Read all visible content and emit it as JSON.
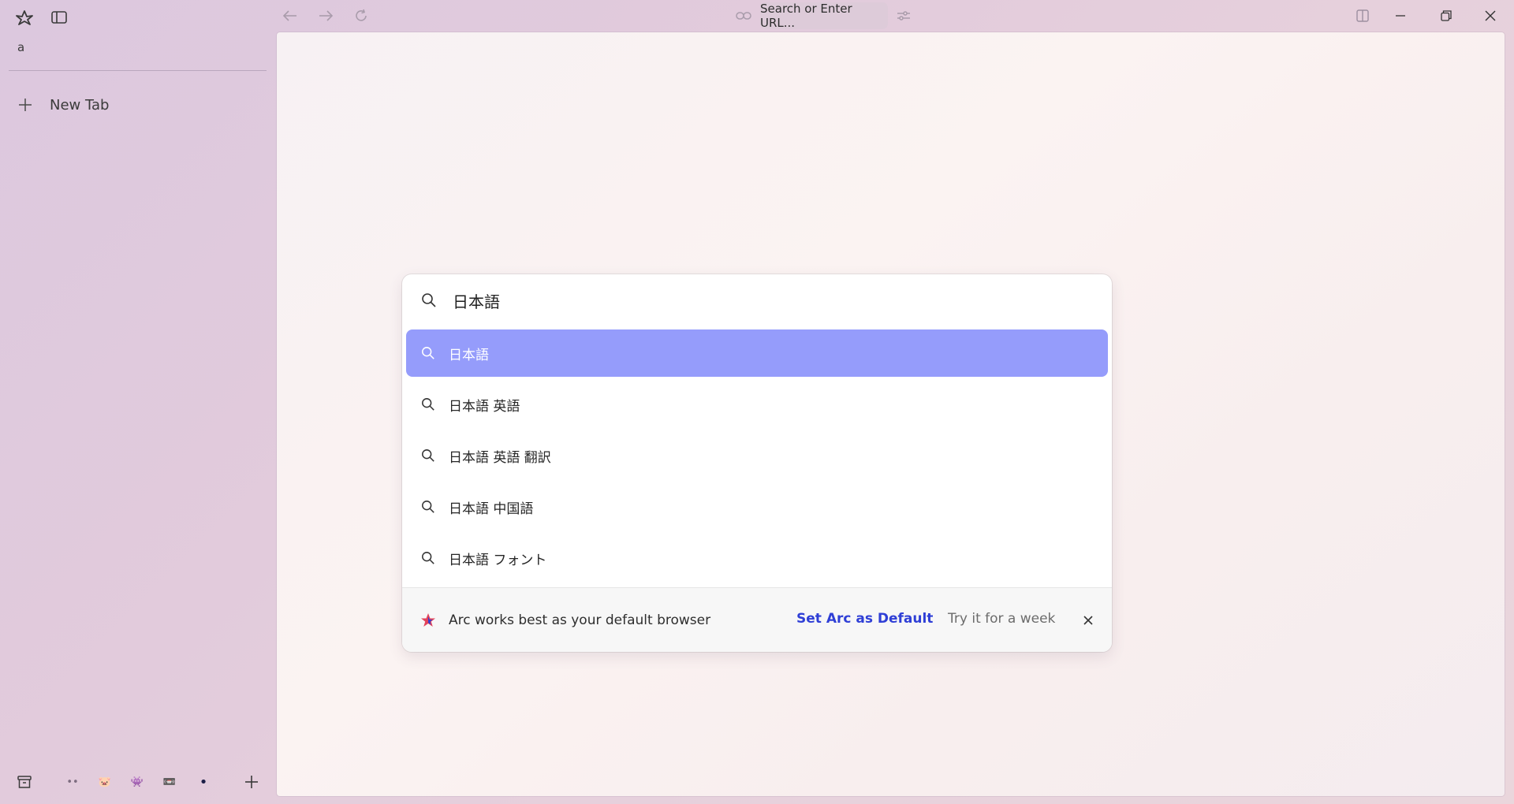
{
  "sidebar": {
    "space_name": "a",
    "new_tab_label": "New Tab",
    "spaces": [
      "••",
      "🐷",
      "👾",
      "📼",
      "•"
    ]
  },
  "toolbar": {
    "url_placeholder": "Search or Enter URL..."
  },
  "command_bar": {
    "query": "日本語",
    "suggestions": [
      {
        "label": "日本語",
        "active": true
      },
      {
        "label": "日本語 英語",
        "active": false
      },
      {
        "label": "日本語 英語 翻訳",
        "active": false
      },
      {
        "label": "日本語 中国語",
        "active": false
      },
      {
        "label": "日本語 フォント",
        "active": false
      }
    ],
    "promo": {
      "message": "Arc works best as your default browser",
      "primary_action": "Set Arc as Default",
      "secondary_action": "Try it for a week"
    }
  },
  "colors": {
    "active_suggestion": "#959cfb",
    "primary_link": "#2f3fd6"
  }
}
